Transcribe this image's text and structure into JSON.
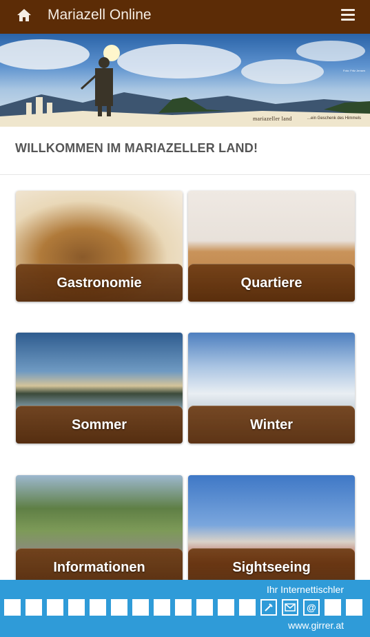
{
  "header": {
    "title": "Mariazell Online",
    "home_icon": "home-icon",
    "menu_icon": "hamburger-menu-icon",
    "background": "#5c2c06"
  },
  "banner": {
    "brand": "mariazeller land",
    "tagline": "...ein Geschenk des Himmels",
    "credit": "Foto: Fritz Jensen"
  },
  "welcome": {
    "heading": "WILLKOMMEN IM MARIAZELLER LAND!"
  },
  "tiles": [
    {
      "label": "Gastronomie"
    },
    {
      "label": "Quartiere"
    },
    {
      "label": "Sommer"
    },
    {
      "label": "Winter"
    },
    {
      "label": "Informationen"
    },
    {
      "label": "Sightseeing"
    }
  ],
  "footer": {
    "top_text": "Ihr Internettischler",
    "url": "www.girrer.at",
    "icons": [
      "tool-icon",
      "email-icon",
      "at-icon"
    ],
    "background": "#2f9bd8"
  }
}
